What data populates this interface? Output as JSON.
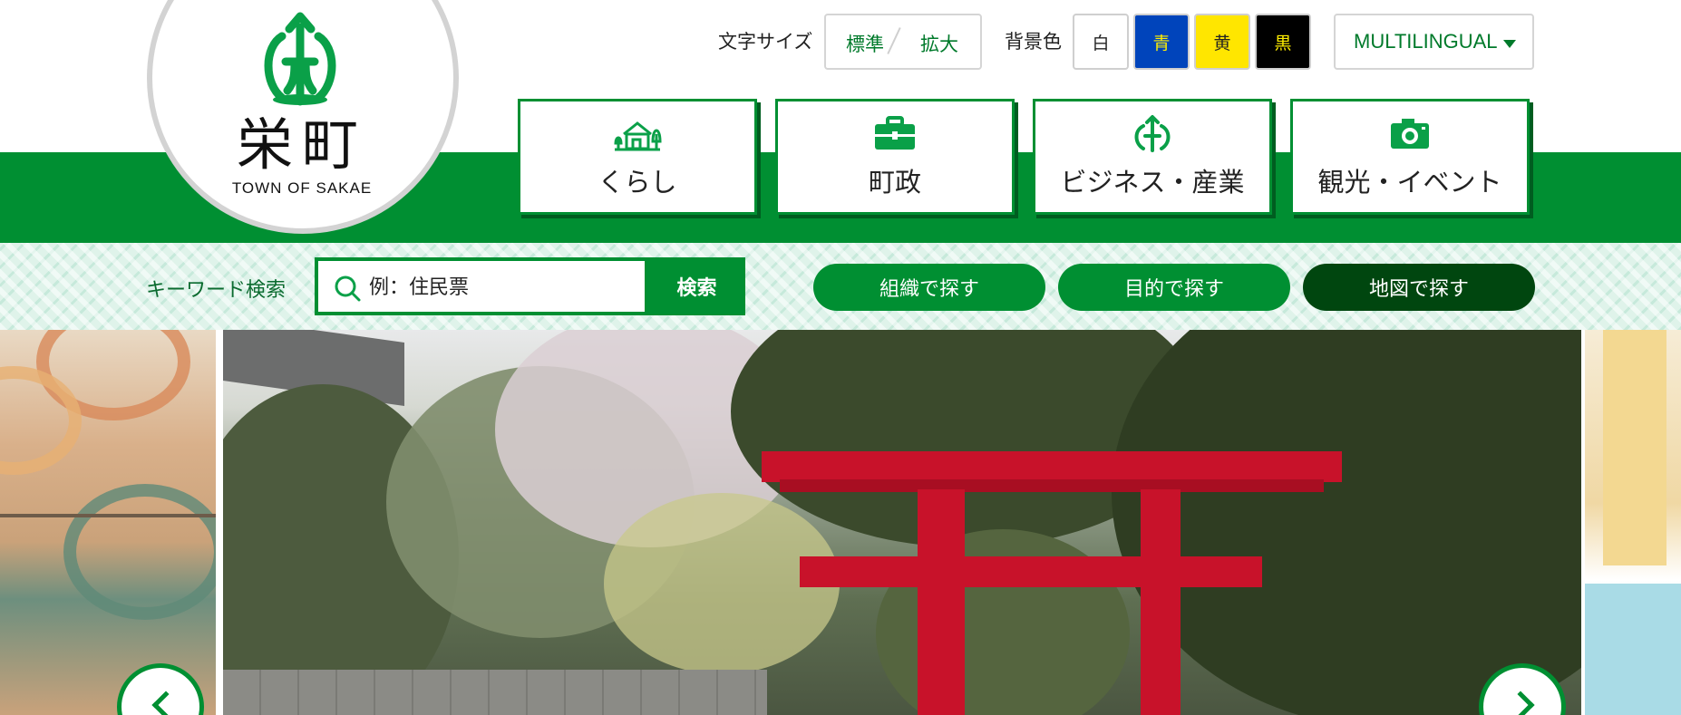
{
  "logo": {
    "name": "栄町",
    "subtitle": "TOWN OF SAKAE"
  },
  "utility": {
    "font_size_label": "文字サイズ",
    "font_size_options": [
      "標準",
      "拡大"
    ],
    "bg_color_label": "背景色",
    "bg_color_options": [
      {
        "label": "白",
        "bg": "#ffffff",
        "fg": "#222222"
      },
      {
        "label": "青",
        "bg": "#0044bb",
        "fg": "#ffee00"
      },
      {
        "label": "黄",
        "bg": "#ffe600",
        "fg": "#222222"
      },
      {
        "label": "黒",
        "bg": "#000000",
        "fg": "#ffee00"
      }
    ],
    "multilingual": "MULTILINGUAL"
  },
  "nav": {
    "items": [
      {
        "label": "くらし",
        "icon": "house-icon"
      },
      {
        "label": "町政",
        "icon": "briefcase-icon"
      },
      {
        "label": "ビジネス・産業",
        "icon": "town-emblem-icon"
      },
      {
        "label": "観光・イベント",
        "icon": "camera-icon"
      }
    ]
  },
  "search": {
    "label": "キーワード検索",
    "placeholder": "例：住民票",
    "button": "検索"
  },
  "find_buttons": [
    {
      "label": "組織で探す",
      "color": "#008f32"
    },
    {
      "label": "目的で探す",
      "color": "#008f32"
    },
    {
      "label": "地図で探す",
      "color": "#00460f"
    }
  ],
  "colors": {
    "brand_green": "#008f32",
    "dark_green": "#00460f",
    "torii_red": "#c8122a"
  }
}
